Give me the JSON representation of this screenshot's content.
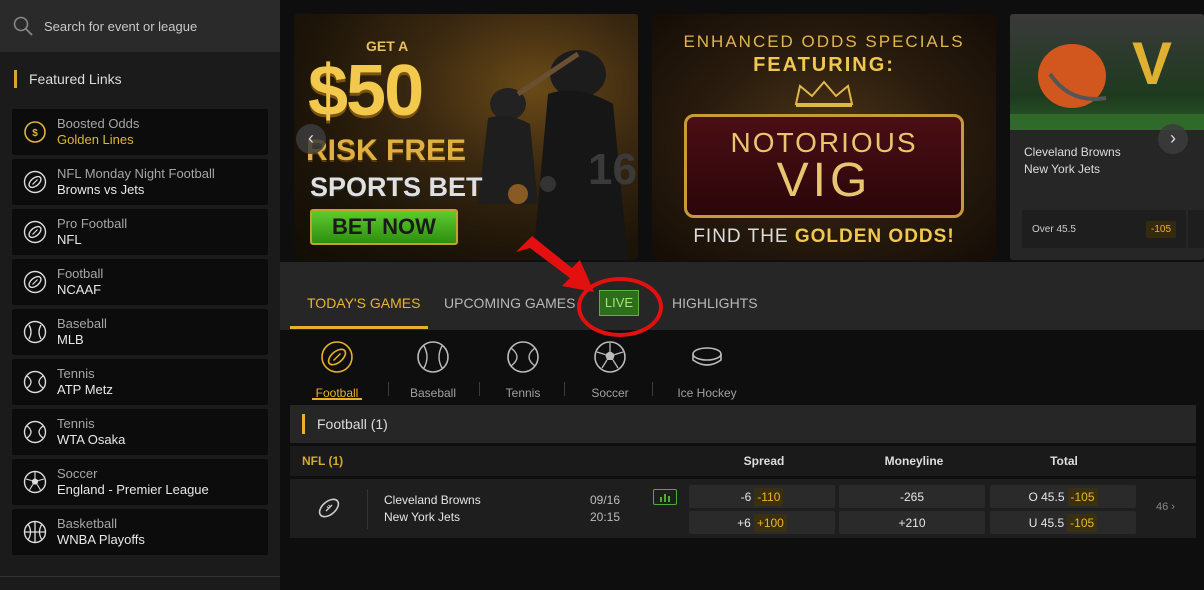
{
  "search": {
    "placeholder": "Search for event or league"
  },
  "sidebar": {
    "heading": "Featured Links",
    "items": [
      {
        "line1": "Boosted Odds",
        "line2": "Golden Lines",
        "icon": "boosted-odds-icon"
      },
      {
        "line1": "NFL Monday Night Football",
        "line2": "Browns vs Jets",
        "icon": "football-icon"
      },
      {
        "line1": "Pro Football",
        "line2": "NFL",
        "icon": "football-icon"
      },
      {
        "line1": "Football",
        "line2": "NCAAF",
        "icon": "football-icon"
      },
      {
        "line1": "Baseball",
        "line2": "MLB",
        "icon": "baseball-icon"
      },
      {
        "line1": "Tennis",
        "line2": "ATP Metz",
        "icon": "tennis-icon"
      },
      {
        "line1": "Tennis",
        "line2": "WTA Osaka",
        "icon": "tennis-icon"
      },
      {
        "line1": "Soccer",
        "line2": "England - Premier League",
        "icon": "soccer-icon"
      },
      {
        "line1": "Basketball",
        "line2": "WNBA Playoffs",
        "icon": "basketball-icon"
      }
    ]
  },
  "banners": {
    "b1": {
      "get_a": "GET A",
      "amount": "$50",
      "risk_free": "RISK FREE",
      "sports_bet": "SPORTS BET",
      "cta": "BET NOW"
    },
    "b2": {
      "line1": "ENHANCED ODDS SPECIALS",
      "line2": "FEATURING:",
      "title1": "NOTORIOUS",
      "title2": "VIG",
      "footer_pre": "FIND THE ",
      "footer_gold": "GOLDEN ODDS!"
    },
    "b3": {
      "team1": "Cleveland Browns",
      "team2": "New York Jets",
      "bet_label": "Over 45.5",
      "bet_odds": "-105"
    }
  },
  "tabs": {
    "today": "TODAY'S GAMES",
    "upcoming": "UPCOMING GAMES",
    "live": "LIVE",
    "highlights": "HIGHLIGHTS"
  },
  "sports": [
    {
      "label": "Football",
      "icon": "football-icon"
    },
    {
      "label": "Baseball",
      "icon": "baseball-icon"
    },
    {
      "label": "Tennis",
      "icon": "tennis-icon"
    },
    {
      "label": "Soccer",
      "icon": "soccer-icon"
    },
    {
      "label": "Ice Hockey",
      "icon": "hockey-puck-icon"
    }
  ],
  "section": {
    "title": "Football (1)"
  },
  "league": {
    "name": "NFL (1)",
    "cols": [
      "Spread",
      "Moneyline",
      "Total"
    ]
  },
  "event": {
    "team1": "Cleveland Browns",
    "team2": "New York Jets",
    "date": "09/16",
    "time": "20:15",
    "spread": [
      {
        "line": "-6",
        "price": "-110"
      },
      {
        "line": "+6",
        "price": "+100"
      }
    ],
    "moneyline": [
      "-265",
      "+210"
    ],
    "total": [
      {
        "line": "O 45.5",
        "price": "-105"
      },
      {
        "line": "U 45.5",
        "price": "-105"
      }
    ],
    "more": "46 ›"
  },
  "colors": {
    "accent": "#e6b228",
    "live_green": "#2c6e1c",
    "annotation_red": "#e41010"
  }
}
